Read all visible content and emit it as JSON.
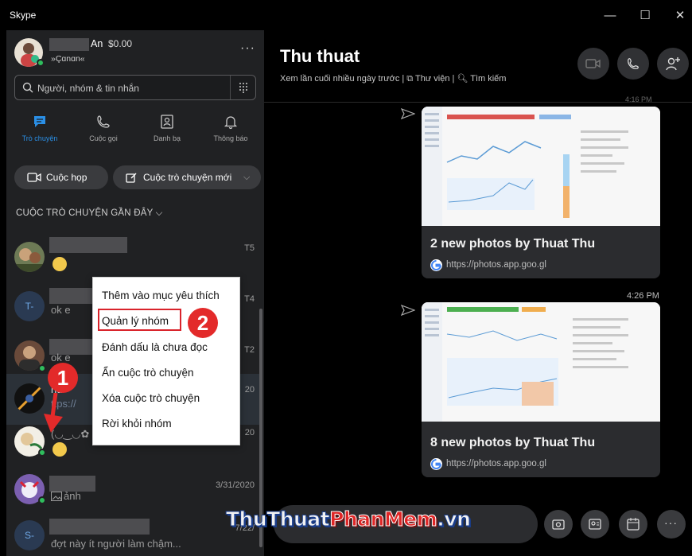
{
  "window": {
    "app_title": "Skype",
    "minimize_glyph": "—",
    "maximize_glyph": "☐",
    "close_glyph": "✕"
  },
  "profile": {
    "name_suffix": "An",
    "balance": "$0.00",
    "status": "»Çɑnɑn«",
    "more_glyph": "···"
  },
  "search": {
    "placeholder": "Người, nhóm & tin nhắn"
  },
  "tabs": [
    {
      "label": "Trò chuyện",
      "icon": "chat-icon",
      "active": true
    },
    {
      "label": "Cuộc gọi",
      "icon": "phone-icon",
      "active": false
    },
    {
      "label": "Danh bạ",
      "icon": "contacts-icon",
      "active": false
    },
    {
      "label": "Thông báo",
      "icon": "bell-icon",
      "active": false
    }
  ],
  "actions": {
    "meeting_label": "Cuộc họp",
    "new_chat_label": "Cuộc trò chuyện mới"
  },
  "recent": {
    "title": "CUỘC TRÒ CHUYỆN GẦN ĐÂY",
    "conversations": [
      {
        "message": "",
        "date": "T5",
        "initial": ""
      },
      {
        "message": "ok e",
        "date": "T4",
        "initial": "T-"
      },
      {
        "message": "ok e",
        "date": "T2",
        "initial": ""
      },
      {
        "message": "ttps://",
        "name_fragment": "hu",
        "date": "20",
        "initial": ""
      },
      {
        "message": "(◡‿◡✿",
        "date": "20",
        "initial": ""
      },
      {
        "message": "ảnh",
        "date": "3/31/2020",
        "initial": ""
      },
      {
        "message": "đợt này ít người làm chậm...",
        "date": "7/22/",
        "initial": "S-"
      }
    ]
  },
  "context_menu": {
    "items": [
      "Thêm vào mục yêu thích",
      "Quản lý nhóm",
      "Đánh dấu là chưa đọc",
      "Ẩn cuộc trò chuyện",
      "Xóa cuộc trò chuyện",
      "Rời khỏi nhóm"
    ]
  },
  "steps": {
    "step1": "1",
    "step2": "2"
  },
  "chat": {
    "title": "Thu thuat",
    "subtitle": "Xem lần cuối nhiều ngày trước | ⧉ Thư viện | 🔍︎ Tìm kiếm",
    "cards": [
      {
        "title": "2 new photos by Thuat Thu",
        "url": "https://photos.app.goo.gl"
      },
      {
        "title": "8 new photos by Thuat Thu",
        "url": "https://photos.app.goo.gl"
      }
    ],
    "timestamp": "4:26 PM",
    "top_partial_ts": "4:16 PM"
  },
  "watermark": {
    "part1": "ThuThuat",
    "part2": "PhanMem",
    "part3": ".vn"
  },
  "colors": {
    "accent": "#2a8fe6",
    "highlight_red": "#d9232b",
    "online_green": "#2fbe5d"
  }
}
